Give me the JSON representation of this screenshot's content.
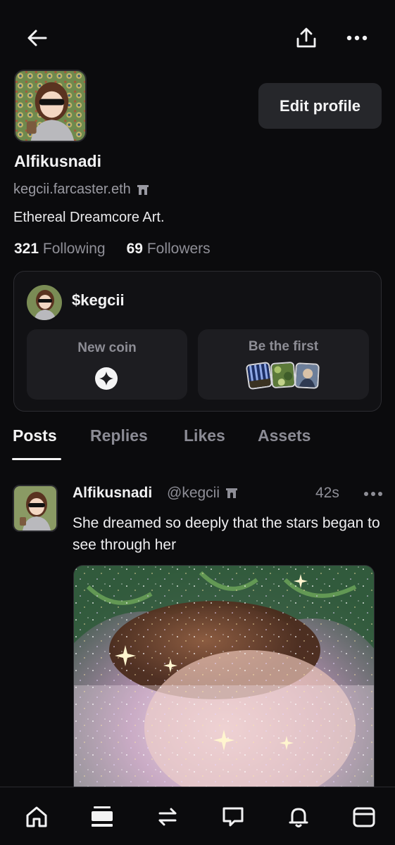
{
  "header": {
    "back_icon": "arrow-left-icon",
    "share_icon": "share-upload-icon",
    "more_icon": "more-horizontal-icon"
  },
  "profile": {
    "display_name": "Alfikusnadi",
    "username": "kegcii.farcaster.eth",
    "username_badge_icon": "arch-gate-icon",
    "bio": "Ethereal Dreamcore Art.",
    "edit_button": "Edit profile",
    "following_count": "321",
    "following_label": "Following",
    "followers_count": "69",
    "followers_label": "Followers"
  },
  "coin_card": {
    "coin_name": "$kegcii",
    "new_coin_label": "New coin",
    "new_coin_icon": "sparkle-icon",
    "be_first_label": "Be the first"
  },
  "tabs": [
    {
      "label": "Posts",
      "active": true
    },
    {
      "label": "Replies",
      "active": false
    },
    {
      "label": "Likes",
      "active": false
    },
    {
      "label": "Assets",
      "active": false
    }
  ],
  "post": {
    "author": "Alfikusnadi",
    "handle": "@kegcii",
    "time": "42s",
    "text": "She dreamed so deeply that the stars began to see through her"
  },
  "bottom_nav": [
    {
      "name": "home",
      "icon": "home-icon"
    },
    {
      "name": "feed",
      "icon": "feed-icon"
    },
    {
      "name": "trade",
      "icon": "swap-arrows-icon"
    },
    {
      "name": "messages",
      "icon": "chat-bubble-icon"
    },
    {
      "name": "notifications",
      "icon": "bell-icon"
    },
    {
      "name": "wallet",
      "icon": "wallet-icon"
    }
  ],
  "colors": {
    "background": "#0b0b0d",
    "card": "#111114",
    "tile": "#1d1d21",
    "button": "#26272b",
    "muted_text": "#8e8e96"
  }
}
